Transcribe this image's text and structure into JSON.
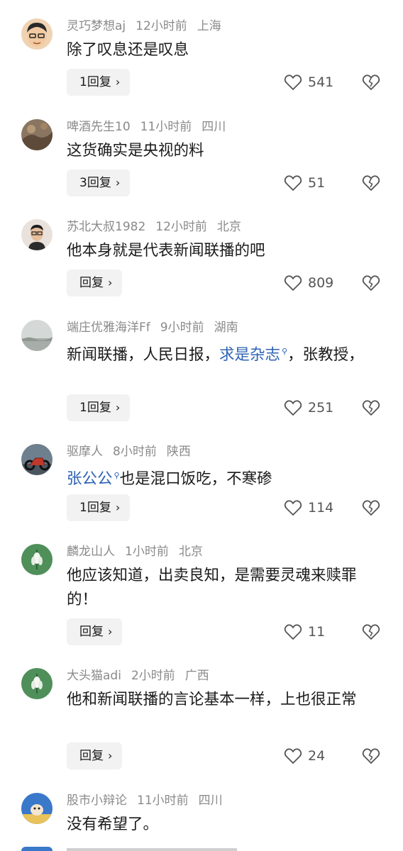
{
  "comments": [
    {
      "user": "灵巧梦想aj",
      "time": "12小时前",
      "loc": "上海",
      "text_plain": "除了叹息还是叹息",
      "reply": "1回复",
      "likes": "541",
      "avatar_color": "#efd3b2"
    },
    {
      "user": "啤酒先生10",
      "time": "11小时前",
      "loc": "四川",
      "text_plain": "这货确实是央视的料",
      "reply": "3回复",
      "likes": "51",
      "avatar_color": "#8a7560"
    },
    {
      "user": "苏北大叔1982",
      "time": "12小时前",
      "loc": "北京",
      "text_plain": "他本身就是代表新闻联播的吧",
      "reply": "回复",
      "likes": "809",
      "avatar_color": "#e9e2dc"
    },
    {
      "user": "端庄优雅海洋Ff",
      "time": "9小时前",
      "loc": "湖南",
      "text_pre": "新闻联播，人民日报，",
      "text_link": "求是杂志",
      "text_post": "，张教授，",
      "reply": "1回复",
      "likes": "251",
      "avatar_color": "#c9cfcc"
    },
    {
      "user": "驱摩人",
      "time": "8小时前",
      "loc": "陕西",
      "text_pre": "",
      "text_link": "张公公",
      "text_post": "也是混口饭吃，不寒碜",
      "reply": "1回复",
      "likes": "114",
      "avatar_color": "#6e7f8e"
    },
    {
      "user": "麟龙山人",
      "time": "1小时前",
      "loc": "北京",
      "text_plain": "他应该知道，出卖良知，是需要灵魂来赎罪的！",
      "reply": "回复",
      "likes": "11",
      "avatar_color": "#4f8f5a"
    },
    {
      "user": "大头猫adi",
      "time": "2小时前",
      "loc": "广西",
      "text_plain": "他和新闻联播的言论基本一样，上也很正常",
      "reply": "回复",
      "likes": "24",
      "avatar_color": "#4f8f5a"
    },
    {
      "user": "股市小辩论",
      "time": "11小时前",
      "loc": "四川",
      "text_plain": "没有希望了。",
      "avatar_color": "#3a78c9"
    }
  ],
  "icons": {
    "like": "heart-outline-icon",
    "dislike": "broken-heart-icon",
    "reply_arrow": "chevron-right-icon",
    "search_tag": "search-icon"
  }
}
